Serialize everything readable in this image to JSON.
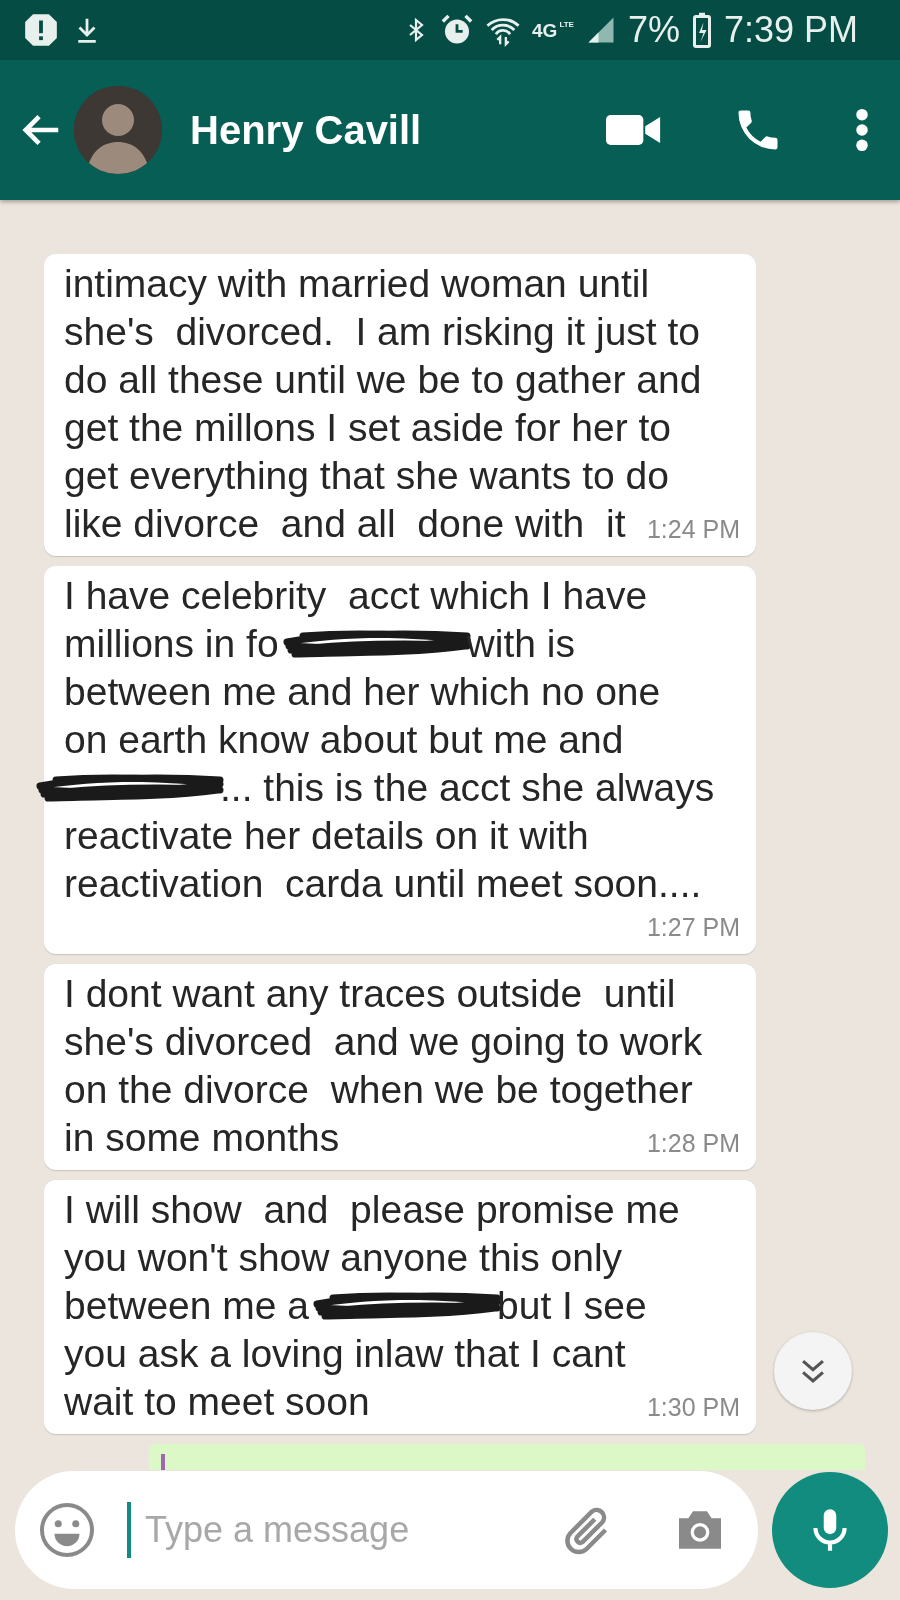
{
  "status_bar": {
    "network": "4G",
    "network_sub": "LTE",
    "battery": "7%",
    "time": "7:39 PM"
  },
  "header": {
    "contact_name": "Henry Cavill"
  },
  "messages": [
    {
      "kind": "incoming",
      "time": "1:24 PM",
      "lines": [
        [
          {
            "kind": "text",
            "text": "intimacy with married woman until"
          }
        ],
        [
          {
            "kind": "text",
            "text": "she's  divorced.  I am risking it just to"
          }
        ],
        [
          {
            "kind": "text",
            "text": "do all these until we be to gather and"
          }
        ],
        [
          {
            "kind": "text",
            "text": "get the millons I set aside for her to"
          }
        ],
        [
          {
            "kind": "text",
            "text": "get everything that she wants to do"
          }
        ],
        [
          {
            "kind": "text",
            "text": "like divorce  and all  done with  it"
          }
        ]
      ]
    },
    {
      "kind": "incoming",
      "time": "1:27 PM",
      "lines": [
        [
          {
            "kind": "text",
            "text": "I have celebrity  acct which I have"
          }
        ],
        [
          {
            "kind": "text",
            "text": "millions in fo"
          },
          {
            "kind": "redaction"
          },
          {
            "kind": "text",
            "text": "with is"
          }
        ],
        [
          {
            "kind": "text",
            "text": "between me and her which no one"
          }
        ],
        [
          {
            "kind": "text",
            "text": "on earth know about but me and"
          }
        ],
        [
          {
            "kind": "redaction"
          },
          {
            "kind": "text",
            "text": "... this is the acct she always"
          }
        ],
        [
          {
            "kind": "text",
            "text": "reactivate her details on it with"
          }
        ],
        [
          {
            "kind": "text",
            "text": "reactivation  carda until meet soon...."
          }
        ]
      ]
    },
    {
      "kind": "incoming",
      "time": "1:28 PM",
      "lines": [
        [
          {
            "kind": "text",
            "text": "I dont want any traces outside  until"
          }
        ],
        [
          {
            "kind": "text",
            "text": "she's divorced  and we going to work"
          }
        ],
        [
          {
            "kind": "text",
            "text": "on the divorce  when we be together"
          }
        ],
        [
          {
            "kind": "text",
            "text": "in some months"
          }
        ]
      ]
    },
    {
      "kind": "incoming",
      "time": "1:30 PM",
      "lines": [
        [
          {
            "kind": "text",
            "text": "I will show  and  please promise me"
          }
        ],
        [
          {
            "kind": "text",
            "text": "you won't show anyone this only"
          }
        ],
        [
          {
            "kind": "text",
            "text": "between me a"
          },
          {
            "kind": "redaction"
          },
          {
            "kind": "text",
            "text": "but I see"
          }
        ],
        [
          {
            "kind": "text",
            "text": "you ask a loving inlaw that I cant"
          }
        ],
        [
          {
            "kind": "text",
            "text": "wait to meet soon"
          }
        ]
      ]
    },
    {
      "kind": "outgoing_partial"
    }
  ],
  "composer": {
    "placeholder": "Type a message"
  }
}
